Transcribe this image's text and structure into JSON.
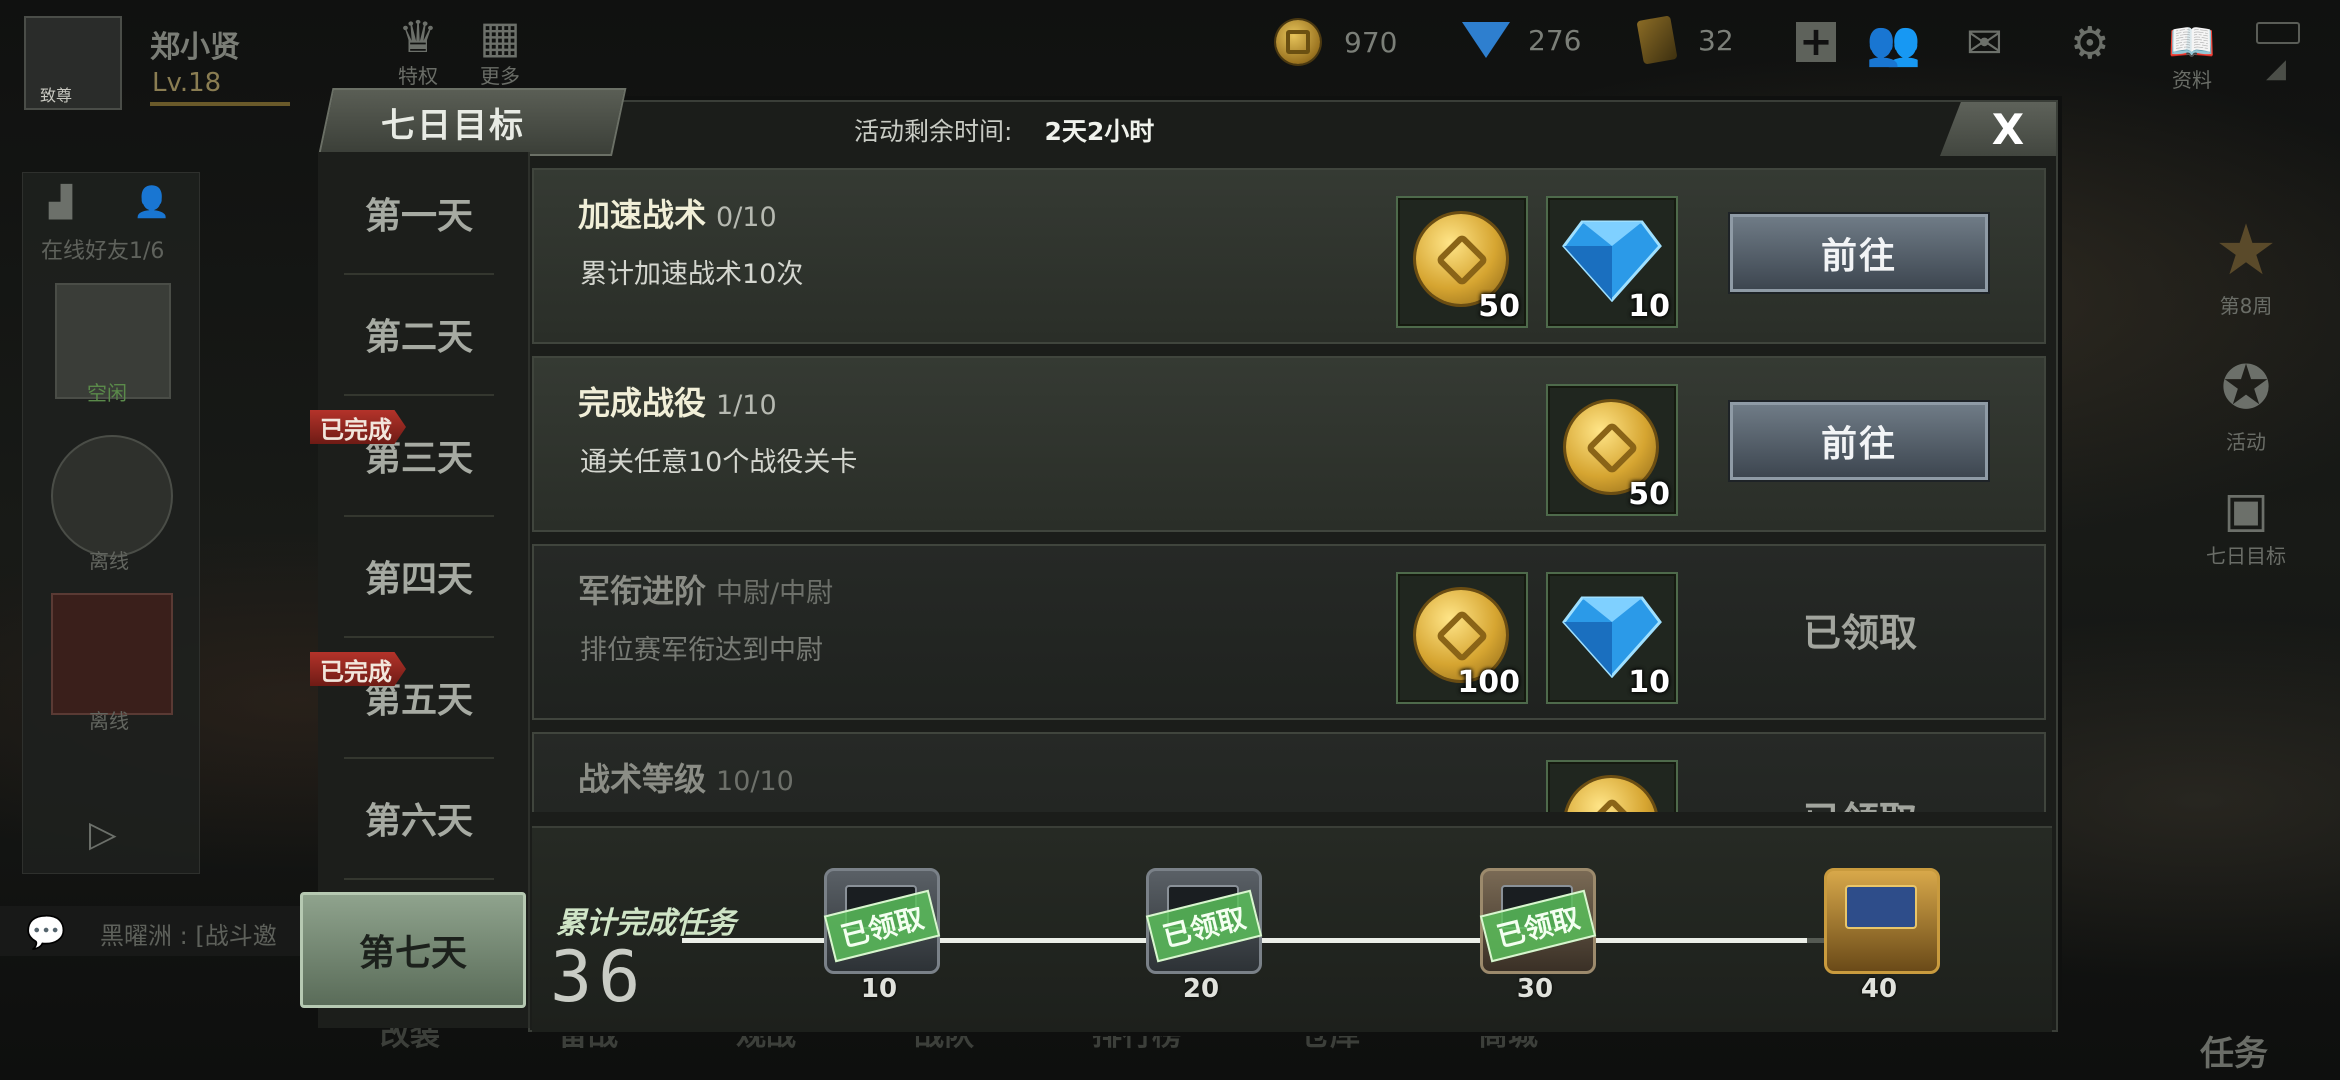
{
  "player": {
    "name": "郑小贤",
    "level": "Lv.18",
    "avatar_badge": "致尊"
  },
  "top_buttons": [
    {
      "label": "特权"
    },
    {
      "label": "更多"
    }
  ],
  "resources": {
    "gold": "970",
    "diamond": "276",
    "ticket": "32"
  },
  "top_icons": [
    {
      "label": "资料"
    }
  ],
  "left_panel": {
    "friends_online": "在线好友1/6",
    "slot1_label": "空闲",
    "slot2_label": "离线",
    "slot3_label": "离线"
  },
  "chat_preview": "黑曜洲 : [战斗邀",
  "right_side": [
    {
      "label": "第8周"
    },
    {
      "label": "活动"
    },
    {
      "label": "七日目标"
    }
  ],
  "bottom_nav_right": "任务",
  "bottom_nav_faded": [
    "改装",
    "备战",
    "观战",
    "战队",
    "排行榜",
    "仓库",
    "商城"
  ],
  "modal": {
    "title": "七日目标",
    "timer_label": "活动剩余时间:",
    "timer_value": "2天2小时",
    "close": "X",
    "days": [
      {
        "label": "第一天",
        "done": false
      },
      {
        "label": "第二天",
        "done": false
      },
      {
        "label": "第三天",
        "done": true
      },
      {
        "label": "第四天",
        "done": false
      },
      {
        "label": "第五天",
        "done": true
      },
      {
        "label": "第六天",
        "done": false
      },
      {
        "label": "第七天",
        "done": false,
        "active": true
      }
    ],
    "done_tag": "已完成",
    "tasks": [
      {
        "name": "加速战术",
        "progress": "0/10",
        "desc": "累计加速战术10次",
        "rewards": [
          {
            "type": "gold-coin-icon",
            "amount": "50"
          },
          {
            "type": "diamond-icon",
            "amount": "10"
          }
        ],
        "action": "前往"
      },
      {
        "name": "完成战役",
        "progress": "1/10",
        "desc": "通关任意10个战役关卡",
        "rewards": [
          {
            "type": "gold-coin-icon",
            "amount": "50"
          }
        ],
        "action": "前往"
      },
      {
        "name": "军衔进阶",
        "progress": "中尉/中尉",
        "desc": "排位赛军衔达到中尉",
        "rewards": [
          {
            "type": "gold-coin-icon",
            "amount": "100"
          },
          {
            "type": "diamond-icon",
            "amount": "10"
          }
        ],
        "action": "已领取"
      },
      {
        "name": "战术等级",
        "progress": "10/10",
        "desc": "",
        "rewards": [
          {
            "type": "gold-coin-icon",
            "amount": ""
          }
        ],
        "action": "已领取"
      }
    ],
    "cumulative": {
      "label": "累计完成任务",
      "count": "36",
      "progress_fraction": 0.9,
      "milestones": [
        {
          "value": "10",
          "claimed": true
        },
        {
          "value": "20",
          "claimed": true
        },
        {
          "value": "30",
          "claimed": true
        },
        {
          "value": "40",
          "claimed": false
        }
      ],
      "claimed_stamp": "已领取"
    }
  }
}
